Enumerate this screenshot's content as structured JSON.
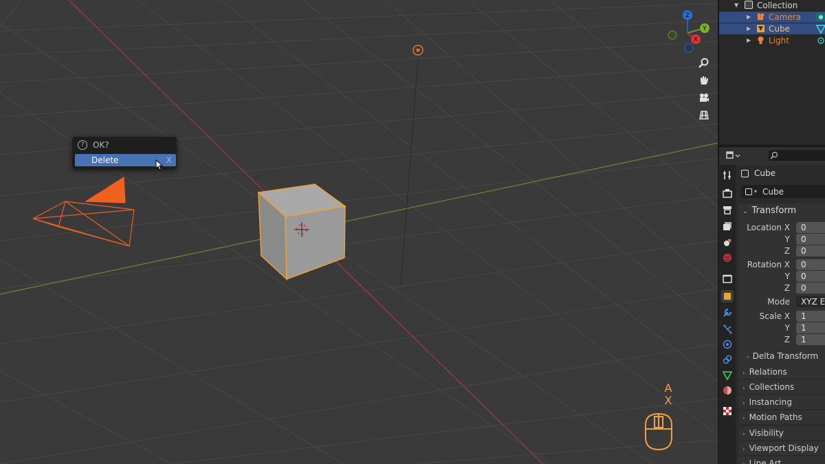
{
  "viewport": {
    "popup": {
      "title": "OK?",
      "item_label": "Delete",
      "item_shortcut": "X"
    },
    "gizmo": {
      "z": "Z",
      "y": "Y",
      "x": "X"
    },
    "key_hints": [
      "A",
      "X"
    ]
  },
  "outliner": {
    "rows": [
      {
        "name": "Collection",
        "color": "#d6d6d6"
      },
      {
        "name": "Camera",
        "color": "#e8833a"
      },
      {
        "name": "Cube",
        "color": "#f0c080"
      },
      {
        "name": "Light",
        "color": "#e8833a"
      }
    ]
  },
  "properties": {
    "object_name": "Cube",
    "data_name": "Cube",
    "transform": {
      "header": "Transform",
      "location_label": "Location X",
      "location": [
        "0",
        "0",
        "0"
      ],
      "rotation_label": "Rotation X",
      "rotation": [
        "0",
        "0",
        "0"
      ],
      "mode_label": "Mode",
      "mode_value": "XYZ Eu",
      "scale_label": "Scale X",
      "scale": [
        "1",
        "1",
        "1"
      ],
      "y_label": "Y",
      "z_label": "Z",
      "delta": "Delta Transform"
    },
    "sections": [
      "Relations",
      "Collections",
      "Instancing",
      "Motion Paths",
      "Visibility",
      "Viewport Display",
      "Line Art"
    ]
  },
  "colors": {
    "accent": "#4772b3",
    "selection": "#f0a030",
    "x_axis": "#a03a45",
    "y_axis": "#6b8a2e"
  }
}
